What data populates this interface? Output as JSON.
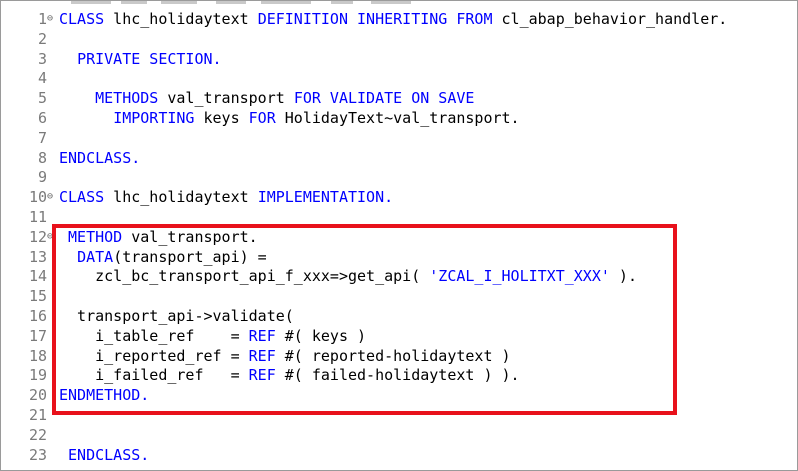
{
  "lines": [
    {
      "n": "1",
      "fold": "⊖",
      "segments": [
        [
          "kw",
          "CLASS"
        ],
        [
          "t",
          " lhc_holidaytext "
        ],
        [
          "kw",
          "DEFINITION INHERITING FROM"
        ],
        [
          "t",
          " cl_abap_behavior_handler."
        ]
      ]
    },
    {
      "n": "2",
      "fold": "",
      "segments": []
    },
    {
      "n": "3",
      "fold": "",
      "segments": [
        [
          "t",
          "  "
        ],
        [
          "kw",
          "PRIVATE SECTION."
        ]
      ]
    },
    {
      "n": "4",
      "fold": "",
      "segments": []
    },
    {
      "n": "5",
      "fold": "",
      "segments": [
        [
          "t",
          "    "
        ],
        [
          "kw",
          "METHODS"
        ],
        [
          "t",
          " val_transport "
        ],
        [
          "kw",
          "FOR VALIDATE ON SAVE"
        ]
      ]
    },
    {
      "n": "6",
      "fold": "",
      "segments": [
        [
          "t",
          "      "
        ],
        [
          "kw",
          "IMPORTING"
        ],
        [
          "t",
          " keys "
        ],
        [
          "kw",
          "FOR"
        ],
        [
          "t",
          " HolidayText~val_transport."
        ]
      ]
    },
    {
      "n": "7",
      "fold": "",
      "segments": []
    },
    {
      "n": "8",
      "fold": "",
      "segments": [
        [
          "kw",
          "ENDCLASS."
        ]
      ]
    },
    {
      "n": "9",
      "fold": "",
      "segments": []
    },
    {
      "n": "10",
      "fold": "⊖",
      "segments": [
        [
          "kw",
          "CLASS"
        ],
        [
          "t",
          " lhc_holidaytext "
        ],
        [
          "kw",
          "IMPLEMENTATION."
        ]
      ]
    },
    {
      "n": "11",
      "fold": "",
      "segments": []
    },
    {
      "n": "12",
      "fold": "⊖",
      "segments": [
        [
          "t",
          " "
        ],
        [
          "kw",
          "METHOD"
        ],
        [
          "t",
          " val_transport."
        ]
      ]
    },
    {
      "n": "13",
      "fold": "",
      "segments": [
        [
          "t",
          "  "
        ],
        [
          "kw",
          "DATA"
        ],
        [
          "t",
          "(transport_api) ="
        ]
      ]
    },
    {
      "n": "14",
      "fold": "",
      "segments": [
        [
          "t",
          "    zcl_bc_transport_api_f_xxx=>get_api( "
        ],
        [
          "str",
          "'ZCAL_I_HOLITXT_XXX'"
        ],
        [
          "t",
          " )."
        ]
      ]
    },
    {
      "n": "15",
      "fold": "",
      "segments": []
    },
    {
      "n": "16",
      "fold": "",
      "segments": [
        [
          "t",
          "  transport_api->validate("
        ]
      ]
    },
    {
      "n": "17",
      "fold": "",
      "segments": [
        [
          "t",
          "    i_table_ref    = "
        ],
        [
          "kw",
          "REF"
        ],
        [
          "t",
          " #( keys )"
        ]
      ]
    },
    {
      "n": "18",
      "fold": "",
      "segments": [
        [
          "t",
          "    i_reported_ref = "
        ],
        [
          "kw",
          "REF"
        ],
        [
          "t",
          " #( reported-holidaytext )"
        ]
      ]
    },
    {
      "n": "19",
      "fold": "",
      "segments": [
        [
          "t",
          "    i_failed_ref   = "
        ],
        [
          "kw",
          "REF"
        ],
        [
          "t",
          " #( failed-holidaytext ) )."
        ]
      ]
    },
    {
      "n": "20",
      "fold": "",
      "segments": [
        [
          "kw",
          "ENDMETHOD."
        ]
      ]
    },
    {
      "n": "21",
      "fold": "",
      "segments": []
    },
    {
      "n": "22",
      "fold": "",
      "segments": []
    },
    {
      "n": "23",
      "fold": "",
      "segments": [
        [
          "t",
          " "
        ],
        [
          "kw",
          "ENDCLASS."
        ]
      ]
    }
  ],
  "colors": {
    "keyword": "#0000ff",
    "string": "#0000ff",
    "text": "#000000",
    "line_number": "#7a7a7a",
    "highlight": "#e8111b"
  }
}
